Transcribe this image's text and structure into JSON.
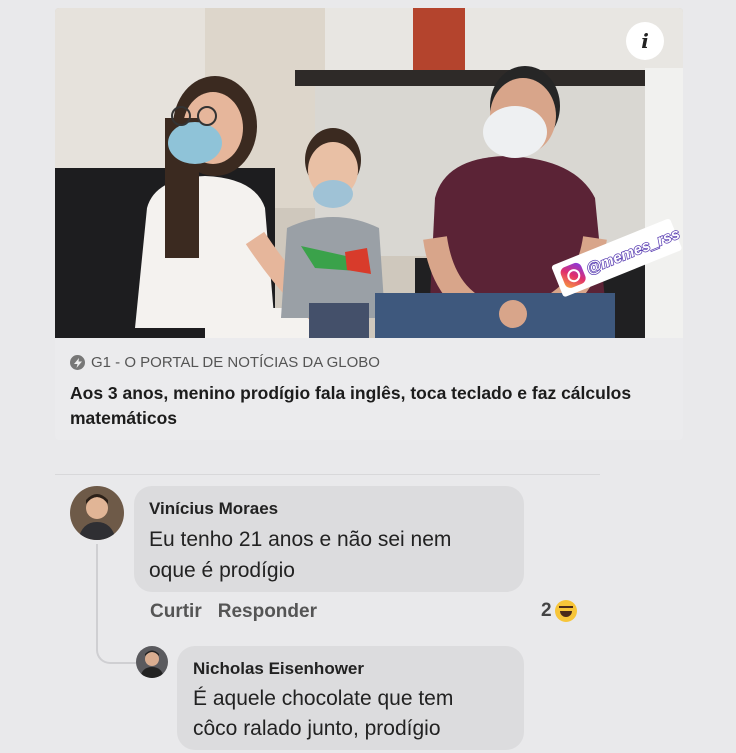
{
  "post": {
    "info_icon": "i",
    "watermark": "@memes_rss",
    "source": "G1 - O PORTAL DE NOTÍCIAS DA GLOBO",
    "headline": "Aos 3 anos, menino prodígio fala inglês, toca teclado e faz cálculos matemáticos"
  },
  "comments": [
    {
      "author": "Vinícius Moraes",
      "line1": "Eu tenho 21 anos e não sei nem",
      "line2": "oque é prodígio",
      "like_label": "Curtir",
      "reply_label": "Responder",
      "reaction_count": "2"
    },
    {
      "author": "Nicholas Eisenhower",
      "line1": "É aquele chocolate que tem",
      "line2": "côco ralado junto, prodígio"
    }
  ],
  "colors": {
    "background": "#e9e9eb",
    "bubble": "#dcdcde",
    "source_text": "#555555"
  }
}
